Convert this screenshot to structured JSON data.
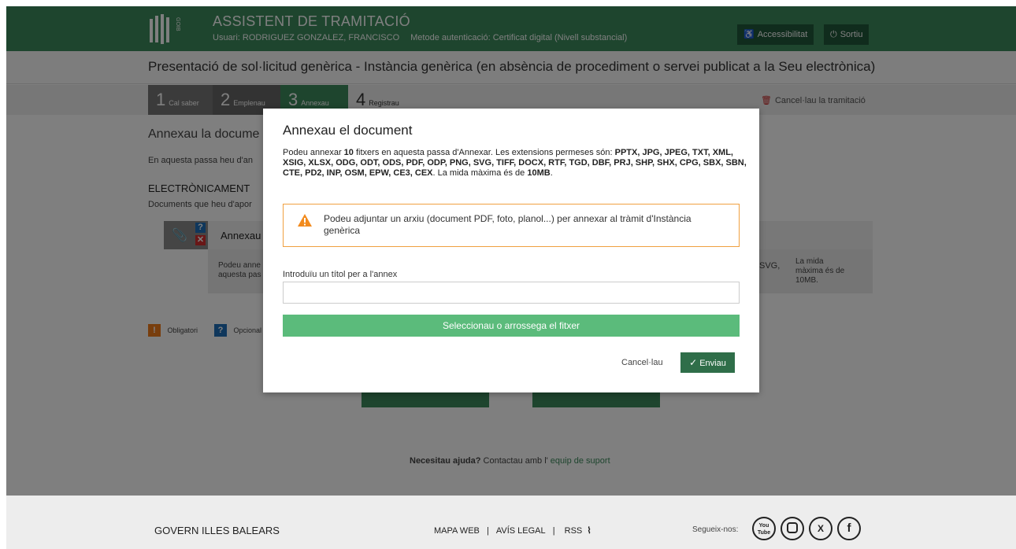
{
  "header": {
    "app_title": "ASSISTENT DE TRAMITACIÓ",
    "user_text": "Usuari: RODRIGUEZ GONZALEZ, FRANCISCO",
    "auth_text": "Metode autenticació: Certificat digital (Nivell substancial)",
    "accessibility_label": "Accessibilitat",
    "exit_label": "Sortiu",
    "logo_text": "GOIB"
  },
  "page_title": "Presentació de sol·licitud genèrica - Instància genèrica (en absència de procediment o servei publicat a la Seu electrònica)",
  "steps": [
    {
      "num": "1",
      "label": "Cal saber"
    },
    {
      "num": "2",
      "label": "Emplenau"
    },
    {
      "num": "3",
      "label": "Annexau"
    },
    {
      "num": "4",
      "label": "Registrau"
    }
  ],
  "cancel_tramit": "Cancel·lau la tramitació",
  "background": {
    "heading": "Annexau la docume",
    "sub": "En aquesta passa heu d'an",
    "electronic": "ELECTRÒNICAMENT",
    "docs_text": "Documents que heu d'apor",
    "doc_title": "Annexau",
    "doc_desc_1": "Podeu anne",
    "doc_desc_2": "aquesta pas",
    "svg_text": "SVG,",
    "max_size_1": "La mida",
    "max_size_2": "màxima és de",
    "max_size_3": "10MB.",
    "mandatory": "Obligatori",
    "optional": "Opcional",
    "help_bold": "Necesitau ajuda?",
    "help_text": " Contactau amb l' ",
    "help_link": "equip de suport"
  },
  "modal": {
    "title": "Annexau el document",
    "intro_1": "Podeu annexar ",
    "intro_count": "10",
    "intro_2": " fitxers en aquesta passa d'Annexar. Les extensions permeses són: ",
    "intro_ext": "PPTX, JPG, JPEG, TXT, XML, XSIG, XLSX, ODG, ODT, ODS, PDF, ODP, PNG, SVG, TIFF, DOCX, RTF, TGD, DBF, PRJ, SHP, SHX, CPG, SBX, SBN, CTE, PD2, INP, OSM, EPW, CE3, CEX",
    "intro_3": ". La mida màxima és de ",
    "intro_size": "10MB",
    "intro_4": ".",
    "warning": "Podeu adjuntar un arxiu (document PDF, foto, planol...) per annexar al tràmit d'Instància genèrica",
    "annex_label": "Introduïu un títol per a l'annex",
    "annex_value": "",
    "select_file": "Seleccionau o arrossega el fitxer",
    "cancel": "Cancel·lau",
    "send": "Enviau"
  },
  "footer": {
    "gov": "GOVERN ILLES BALEARS",
    "map": "MAPA WEB",
    "legal": "AVÍS LEGAL",
    "rss": "RSS",
    "sep": "|",
    "follow": "Segueix-nos:",
    "social": [
      "You Tube",
      "Instagram",
      "X",
      "f"
    ]
  },
  "colors": {
    "header_green": "#3c8a5c",
    "button_dark_green": "#21583b",
    "select_green": "#5bbb7b",
    "send_green": "#2f6e49",
    "warning_orange": "#f0a040",
    "danger_red": "#c62828"
  }
}
